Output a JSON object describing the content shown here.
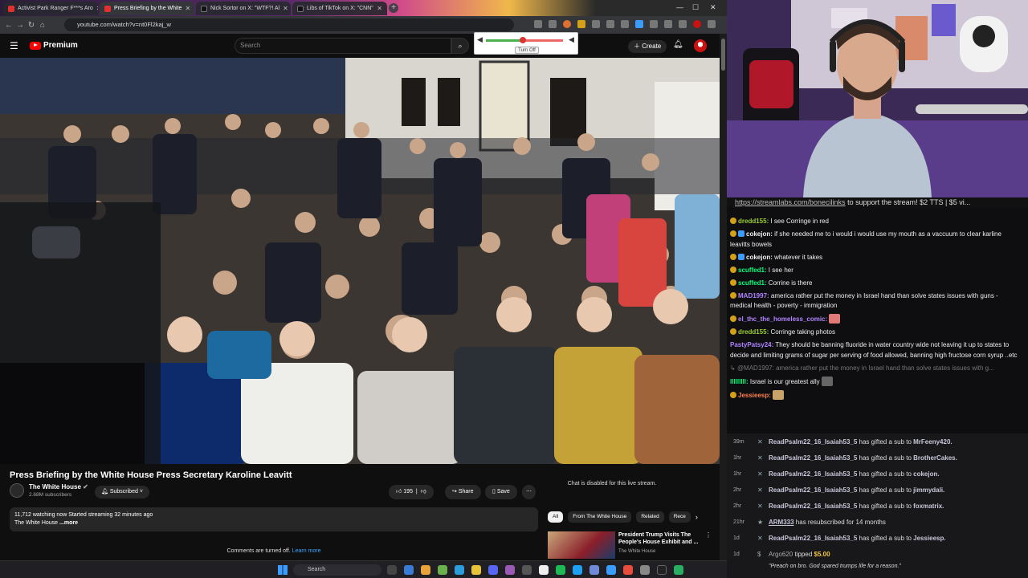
{
  "browser": {
    "tabs": [
      {
        "label": "Activist Park Ranger F***s Aro",
        "active": false,
        "color": "#e03030"
      },
      {
        "label": "Press Briefing by the White",
        "active": true,
        "color": "#e03030"
      },
      {
        "label": "Nick Sortor on X: \"WTF?! Al",
        "active": false,
        "color": "#222222"
      },
      {
        "label": "Libs of TikTok on X: \"CNN\"",
        "active": false,
        "color": "#222222"
      }
    ],
    "url": "youtube.com/watch?v=nt0Fl2kaj_w",
    "new_tab": "+"
  },
  "youtube": {
    "logo": "Premium",
    "search_placeholder": "Search",
    "create_label": "Create",
    "volume_popup": {
      "button": "Turn Off"
    },
    "video_title": "Press Briefing by the White House Press Secretary Karoline Leavitt",
    "channel_name": "The White House",
    "subscribers": "2.68M subscribers",
    "subscribed_label": "Subscribed",
    "likes": "195",
    "share_label": "Share",
    "save_label": "Save",
    "more_label": "⋯",
    "description_line1": "11,712 watching now  Started streaming 32 minutes ago",
    "description_line2": "The White House",
    "description_more": "...more",
    "comments_off": "Comments are turned off.",
    "learn_more": "Learn more",
    "chat_disabled": "Chat is disabled for this live stream.",
    "chips": [
      "All",
      "From The White House",
      "Related",
      "Rece"
    ],
    "related": {
      "title": "President Trump Visits The People's House Exhibit and ...",
      "channel": "The White House"
    }
  },
  "taskbar": {
    "search_placeholder": "Search"
  },
  "stream": {
    "ticker_link": "https://streamlabs.com/bonecilinks",
    "ticker_text": " to support the stream! $2 TTS | $5 vi...",
    "chat": [
      {
        "user": "dredd155:",
        "color": "#9acd32",
        "text": " I see Corringe in red",
        "badge": "#d4a017"
      },
      {
        "user": "cokejon:",
        "color": "#ffffff",
        "text": " if she needed me to i would i would use my mouth as a vaccuum to clear karline leavitts bowels",
        "badge": "#3a9cff"
      },
      {
        "user": "cokejon:",
        "color": "#ffffff",
        "text": " whatever it takes",
        "badge": "#3a9cff"
      },
      {
        "user": "scuffed1:",
        "color": "#00ff7f",
        "text": " I see her",
        "badge": "#d4a017"
      },
      {
        "user": "scuffed1:",
        "color": "#00ff7f",
        "text": " Corrine is there",
        "badge": "#d4a017"
      },
      {
        "user": "MAD1997:",
        "color": "#b084ff",
        "text": " america rather put the money in Israel hand than solve states issues with guns - medical health - poverty - immigration",
        "badge": "#d4a017"
      },
      {
        "user": "el_thc_the_homeless_comic:",
        "color": "#b084ff",
        "text": " ",
        "badge": "#d4a017"
      },
      {
        "user": "dredd155:",
        "color": "#9acd32",
        "text": " Corringe taking photos",
        "badge": "#d4a017"
      },
      {
        "user": "PastyPatsy24:",
        "color": "#b084ff",
        "text": " They should be banning fluoride in water country wide not leaving it up to states to decide and limiting grams of sugar per serving of food allowed, banning high fructose corn syrup ..etc",
        "badge": ""
      },
      {
        "user": "@MAD1997:",
        "color": "#777777",
        "text": " america rather put the money in Israel hand than solve states issues with g...",
        "badge": "",
        "dim": true
      },
      {
        "user": "lllllllll:",
        "color": "#00ff7f",
        "text": " Israel is our greatest ally",
        "badge": ""
      },
      {
        "user": "Jessieesp:",
        "color": "#ff7f50",
        "text": " ",
        "badge": "#d4a017"
      }
    ],
    "events": [
      {
        "time": "39m",
        "gifter": "ReadPsalm22_16_Isaiah53_5",
        "action": " has gifted a sub to ",
        "target": "MrFeeny420."
      },
      {
        "time": "1hr",
        "gifter": "ReadPsalm22_16_Isaiah53_5",
        "action": " has gifted a sub to ",
        "target": "BrotherCakes."
      },
      {
        "time": "1hr",
        "gifter": "ReadPsalm22_16_Isaiah53_5",
        "action": " has gifted a sub to ",
        "target": "cokejon."
      },
      {
        "time": "2hr",
        "gifter": "ReadPsalm22_16_Isaiah53_5",
        "action": " has gifted a sub to ",
        "target": "jimmydali."
      },
      {
        "time": "2hr",
        "gifter": "ReadPsalm22_16_Isaiah53_5",
        "action": " has gifted a sub to ",
        "target": "foxmatrix."
      },
      {
        "time": "21hr",
        "gifter": "ARM333",
        "action": " has resubscribed for 14 months",
        "target": ""
      },
      {
        "time": "1d",
        "gifter": "ReadPsalm22_16_Isaiah53_5",
        "action": " has gifted a sub to ",
        "target": "Jessieesp."
      },
      {
        "time": "1d",
        "gifter": "Argo620",
        "action": " tipped ",
        "target": "$5.00",
        "note": "\"Preach on bro. God spared trumps life for a reason.\""
      }
    ]
  }
}
